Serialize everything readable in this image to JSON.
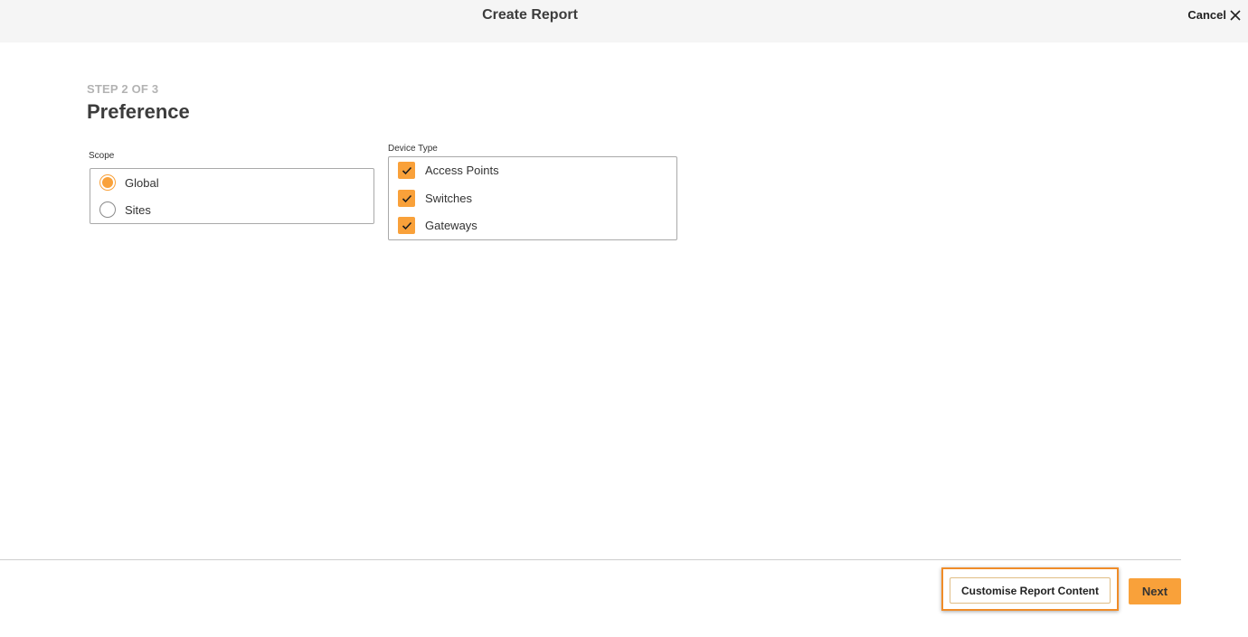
{
  "header": {
    "title": "Create Report",
    "cancel_label": "Cancel"
  },
  "step": {
    "indicator": "STEP 2 OF 3",
    "title": "Preference"
  },
  "scope": {
    "label": "Scope",
    "options": [
      {
        "label": "Global",
        "selected": true
      },
      {
        "label": "Sites",
        "selected": false
      }
    ]
  },
  "device_type": {
    "label": "Device Type",
    "options": [
      {
        "label": "Access Points",
        "checked": true
      },
      {
        "label": "Switches",
        "checked": true
      },
      {
        "label": "Gateways",
        "checked": true
      }
    ]
  },
  "footer": {
    "customise_label": "Customise Report Content",
    "next_label": "Next"
  },
  "colors": {
    "accent": "#f9a13a",
    "highlight": "#f08c28",
    "header_bg": "#f5f5f5"
  },
  "icons": {
    "cancel": "close-icon",
    "check": "checkmark-icon"
  }
}
